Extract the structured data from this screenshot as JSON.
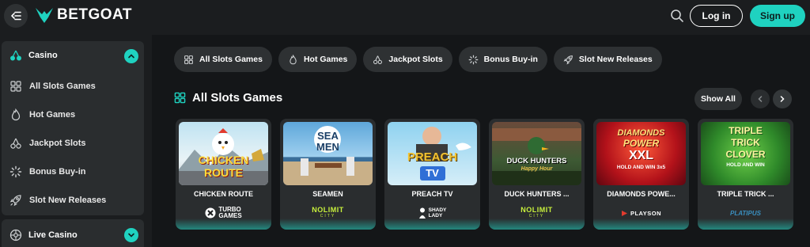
{
  "header": {
    "brand": "BETGOAT",
    "login_label": "Log in",
    "signup_label": "Sign up"
  },
  "sidebar": {
    "casino": {
      "label": "Casino",
      "items": [
        {
          "label": "All Slots Games",
          "icon": "grid-icon"
        },
        {
          "label": "Hot Games",
          "icon": "flame-icon"
        },
        {
          "label": "Jackpot Slots",
          "icon": "cherries-icon"
        },
        {
          "label": "Bonus Buy-in",
          "icon": "spinner-icon"
        },
        {
          "label": "Slot New Releases",
          "icon": "rocket-icon"
        }
      ]
    },
    "live_casino": {
      "label": "Live Casino"
    }
  },
  "categories": [
    {
      "label": "All Slots Games",
      "icon": "grid-icon"
    },
    {
      "label": "Hot Games",
      "icon": "flame-icon"
    },
    {
      "label": "Jackpot Slots",
      "icon": "cherries-icon"
    },
    {
      "label": "Bonus Buy-in",
      "icon": "spinner-icon"
    },
    {
      "label": "Slot New Releases",
      "icon": "rocket-icon"
    }
  ],
  "section": {
    "title": "All Slots Games",
    "show_all_label": "Show All"
  },
  "games": [
    {
      "title": "CHICKEN ROUTE",
      "thumb_text_1": "CHICKEN",
      "thumb_text_2": "ROUTE",
      "provider_1": "TURBO",
      "provider_2": "GAMES"
    },
    {
      "title": "SEAMEN",
      "thumb_text_1": "SEA",
      "thumb_text_2": "MEN",
      "provider_1": "NOLIMIT",
      "provider_2": "CITY"
    },
    {
      "title": "PREACH TV",
      "thumb_text_1": "PREACH",
      "thumb_text_2": "TV",
      "provider_1": "SHADY",
      "provider_2": "LADY"
    },
    {
      "title": "DUCK HUNTERS ...",
      "thumb_text_1": "DUCK HUNTERS",
      "thumb_text_2": "Happy Hour",
      "provider_1": "NOLIMIT",
      "provider_2": "CITY"
    },
    {
      "title": "DIAMONDS POWE...",
      "thumb_text_1": "DIAMONDS",
      "thumb_text_2": "POWER",
      "thumb_text_3": "XXL",
      "thumb_text_4": "HOLD AND WIN 3x5",
      "provider_1": "PLAYSON"
    },
    {
      "title": "TRIPLE TRICK ...",
      "thumb_text_1": "TRIPLE",
      "thumb_text_2": "TRICK",
      "thumb_text_3": "CLOVER",
      "thumb_text_4": "HOLD AND WIN",
      "provider_1": "PLATIPUS"
    }
  ],
  "colors": {
    "accent": "#1fd2c0",
    "background": "#141618",
    "surface": "#2a2d2f",
    "pill": "#2e3133"
  }
}
